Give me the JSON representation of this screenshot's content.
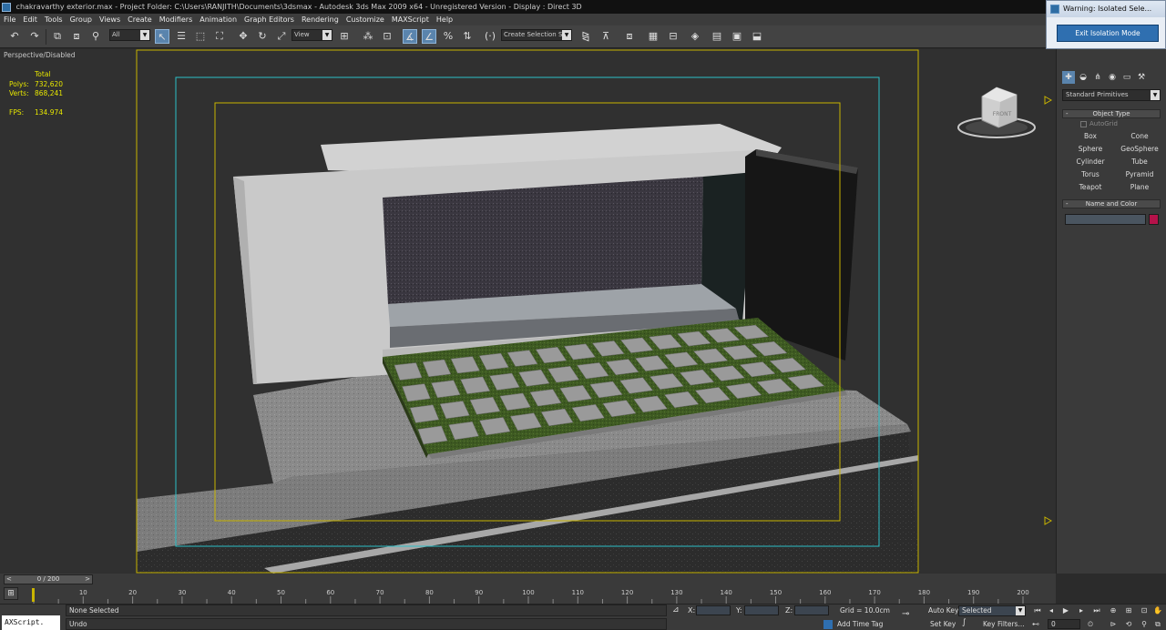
{
  "window": {
    "title": "chakravarthy exterior.max    - Project Folder: C:\\Users\\RANJITH\\Documents\\3dsmax    - Autodesk 3ds Max  2009 x64    - Unregistered Version    - Display : Direct 3D"
  },
  "menu": [
    "File",
    "Edit",
    "Tools",
    "Group",
    "Views",
    "Create",
    "Modifiers",
    "Animation",
    "Graph Editors",
    "Rendering",
    "Customize",
    "MAXScript",
    "Help"
  ],
  "toolbar": {
    "selection_filter": "All",
    "reference_coord": "View",
    "named_selection": "Create Selection Se"
  },
  "viewport": {
    "label": "Perspective/Disabled",
    "stats": {
      "header": "Total",
      "polys_label": "Polys:",
      "polys_value": "732,620",
      "verts_label": "Verts:",
      "verts_value": "868,241",
      "fps_label": "FPS:",
      "fps_value": "134.974"
    },
    "viewcube_label": "FRONT"
  },
  "warning_window": {
    "title": "Warning: Isolated Sele...",
    "button": "Exit Isolation Mode"
  },
  "command_panel": {
    "category": "Standard Primitives",
    "object_type_title": "Object Type",
    "autogrid": "AutoGrid",
    "primitives": [
      "Box",
      "Cone",
      "Sphere",
      "GeoSphere",
      "Cylinder",
      "Tube",
      "Torus",
      "Pyramid",
      "Teapot",
      "Plane"
    ],
    "name_color_title": "Name and Color",
    "object_color": "#b5124a"
  },
  "timeline": {
    "slider_label": "0 / 200",
    "ticks": [
      10,
      20,
      30,
      40,
      50,
      60,
      70,
      80,
      90,
      100,
      110,
      120,
      130,
      140,
      150,
      160,
      170,
      180,
      190,
      200
    ]
  },
  "status": {
    "listener": "AXScript.",
    "message1": "None Selected",
    "message2": "Undo",
    "x_label": "X:",
    "y_label": "Y:",
    "z_label": "Z:",
    "grid": "Grid = 10.0cm",
    "add_time_tag": "Add Time Tag",
    "auto_key": "Auto Key",
    "selected": "Selected",
    "set_key": "Set Key",
    "key_filters": "Key Filters...",
    "current_frame": "0"
  }
}
